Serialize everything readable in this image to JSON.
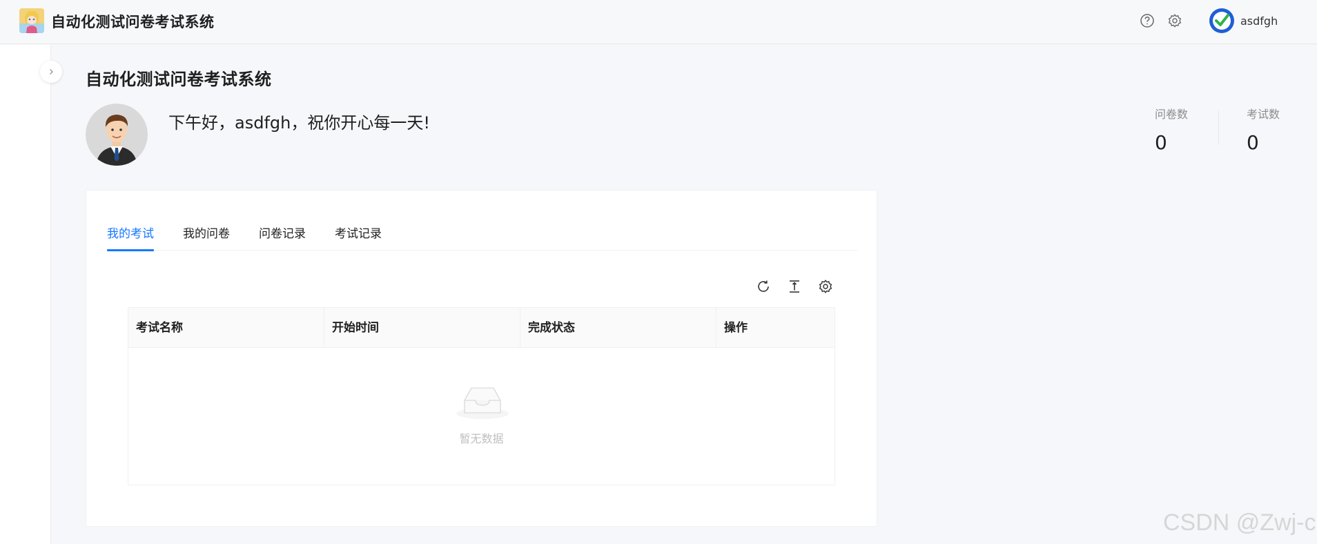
{
  "header": {
    "app_title": "自动化测试问卷考试系统",
    "help_icon": "question-circle-icon",
    "settings_icon": "gear-icon",
    "user_name": "asdfgh"
  },
  "page": {
    "title": "自动化测试问卷考试系统",
    "greeting": "下午好，asdfgh，祝你开心每一天!"
  },
  "stats": [
    {
      "label": "问卷数",
      "value": "0"
    },
    {
      "label": "考试数",
      "value": "0"
    }
  ],
  "tabs": [
    {
      "label": "我的考试",
      "active": true
    },
    {
      "label": "我的问卷",
      "active": false
    },
    {
      "label": "问卷记录",
      "active": false
    },
    {
      "label": "考试记录",
      "active": false
    }
  ],
  "toolbar": {
    "icons": [
      "reload-icon",
      "column-height-icon",
      "setting-icon"
    ]
  },
  "table": {
    "columns": [
      "考试名称",
      "开始时间",
      "完成状态",
      "操作"
    ],
    "rows": [],
    "empty_text": "暂无数据"
  },
  "watermark": "CSDN @Zwj-c",
  "colors": {
    "accent": "#1677ff",
    "background": "#f5f7fa",
    "header_bg": "#f7f8fa"
  }
}
